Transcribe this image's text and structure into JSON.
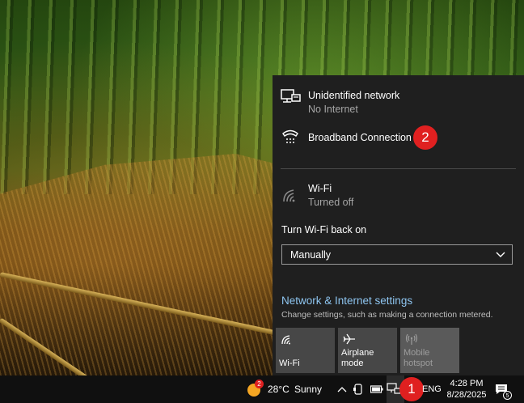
{
  "flyout": {
    "networks": [
      {
        "name": "Unidentified network",
        "status": "No Internet",
        "icon": "ethernet-monitor-icon"
      },
      {
        "name": "Broadband Connection",
        "status": "",
        "icon": "dialup-phone-icon"
      },
      {
        "name": "Wi-Fi",
        "status": "Turned off",
        "icon": "wifi-off-icon"
      }
    ],
    "turn_on_label": "Turn Wi-Fi back on",
    "dropdown_value": "Manually",
    "settings_link": "Network & Internet settings",
    "settings_desc": "Change settings, such as making a connection metered.",
    "tiles": [
      {
        "label": "Wi-Fi",
        "icon": "wifi-icon",
        "enabled": true
      },
      {
        "label": "Airplane mode",
        "icon": "airplane-icon",
        "enabled": true
      },
      {
        "label": "Mobile hotspot",
        "icon": "hotspot-icon",
        "enabled": false
      }
    ]
  },
  "annotations": {
    "badge1": "1",
    "badge2": "2"
  },
  "taskbar": {
    "weather_temp": "28°C",
    "weather_text": "Sunny",
    "weather_alert": "2",
    "language": "ENG",
    "time": "4:28 PM",
    "date": "8/28/2025",
    "notification_count": "5"
  },
  "colors": {
    "flyout_bg": "#1f1f1f",
    "link": "#8ec5f0",
    "badge": "#e02020",
    "taskbar": "#101010"
  }
}
